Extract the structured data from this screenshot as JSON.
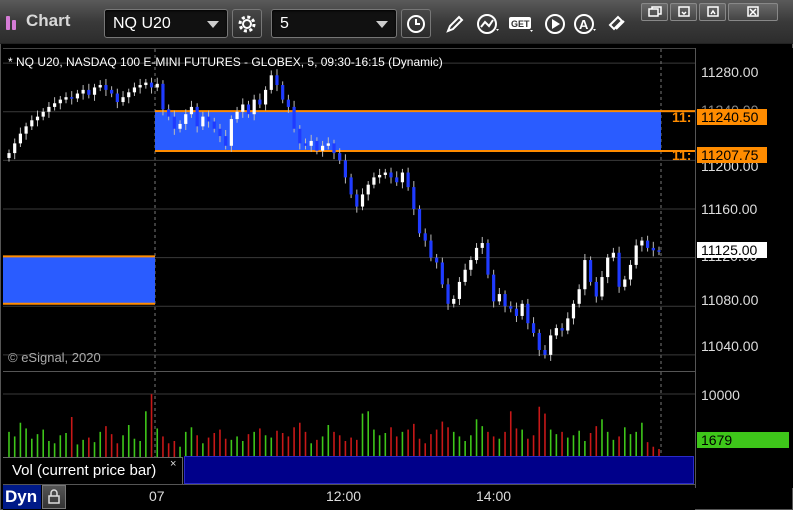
{
  "app": {
    "title": "Chart"
  },
  "toolbar": {
    "symbol": "NQ U20",
    "interval": "5",
    "icons": [
      "settings-gear-icon",
      "clock-icon",
      "pencil-draw-icon",
      "study-chart-icon",
      "get-quote-icon",
      "play-replay-icon",
      "alert-a-icon",
      "link-icon"
    ]
  },
  "window_controls": [
    "restore-icon",
    "minimize-icon",
    "maximize-icon",
    "close-icon"
  ],
  "chart": {
    "header": "* NQ U20, NASDAQ 100 E-MINI FUTURES - GLOBEX, 5, 09:30-16:15 (Dynamic)",
    "copyright": "© eSignal, 2020",
    "y_ticks": [
      "11280.00",
      "11240.00",
      "11200.00",
      "11160.00",
      "11120.00",
      "11080.00",
      "11040.00"
    ],
    "price_tags": {
      "upper": "11240.50",
      "lower": "11207.75",
      "last": "11125.00"
    },
    "clip_labels": {
      "upper": "11:",
      "lower": "11:"
    },
    "zone_color": "#2a5cff",
    "line_color": "#ff8c00",
    "up_color": "#ffffff",
    "down_color": "#1f3bff"
  },
  "volume": {
    "legend": "Vol (current price bar)",
    "close": "×",
    "y_tick": "10000",
    "last": "1679",
    "up_color": "#3ec61a",
    "down_color": "#c81818"
  },
  "time_axis": {
    "labels": [
      "07",
      "12:00",
      "14:00"
    ]
  },
  "footer": {
    "mode": "Dyn"
  },
  "chart_data": {
    "type": "candlestick",
    "title": "NQ U20, NASDAQ 100 E-MINI FUTURES - GLOBEX, 5, 09:30-16:15 (Dynamic)",
    "ylim": [
      11030,
      11290
    ],
    "zones": [
      {
        "from": 11207.75,
        "to": 11240.5
      },
      {
        "from": 11082,
        "to": 11121
      }
    ],
    "last_price": 11125.0,
    "volume_last": 1679,
    "closes": [
      11206,
      11214,
      11222,
      11228,
      11233,
      11236,
      11240,
      11244,
      11247,
      11250,
      11252,
      11251,
      11255,
      11258,
      11254,
      11260,
      11262,
      11258,
      11255,
      11248,
      11252,
      11256,
      11260,
      11262,
      11264,
      11260,
      11263,
      11242,
      11236,
      11226,
      11230,
      11238,
      11244,
      11228,
      11236,
      11232,
      11226,
      11220,
      11212,
      11234,
      11240,
      11246,
      11238,
      11250,
      11246,
      11258,
      11270,
      11262,
      11250,
      11244,
      11226,
      11214,
      11212,
      11216,
      11208,
      11212,
      11214,
      11206,
      11200,
      11186,
      11172,
      11162,
      11172,
      11180,
      11186,
      11188,
      11190,
      11186,
      11182,
      11190,
      11178,
      11160,
      11140,
      11134,
      11120,
      11116,
      11098,
      11082,
      11086,
      11100,
      11110,
      11118,
      11128,
      11132,
      11106,
      11084,
      11090,
      11080,
      11078,
      11072,
      11082,
      11066,
      11058,
      11044,
      11040,
      11056,
      11062,
      11060,
      11070,
      11082,
      11094,
      11118,
      11100,
      11088,
      11104,
      11120,
      11124,
      11096,
      11102,
      11114,
      11130,
      11134,
      11128,
      11126,
      11125
    ],
    "volume": [
      22,
      18,
      30,
      25,
      16,
      20,
      24,
      14,
      12,
      19,
      21,
      35,
      11,
      15,
      17,
      13,
      22,
      27,
      20,
      12,
      19,
      28,
      16,
      14,
      40,
      55,
      25,
      18,
      12,
      14,
      9,
      22,
      26,
      19,
      12,
      17,
      21,
      24,
      16,
      15,
      18,
      14,
      20,
      22,
      25,
      19,
      17,
      23,
      21,
      18,
      26,
      30,
      22,
      12,
      15,
      18,
      28,
      22,
      19,
      14,
      17,
      15,
      38,
      40,
      24,
      19,
      21,
      26,
      18,
      22,
      24,
      29,
      16,
      12,
      20,
      24,
      31,
      26,
      22,
      18,
      14,
      19,
      33,
      27,
      22,
      18,
      16,
      22,
      40,
      25,
      24,
      16,
      19,
      44,
      38,
      24,
      20,
      22,
      17,
      19,
      23,
      14,
      21,
      27,
      33,
      22,
      15,
      18,
      26,
      20,
      22,
      30,
      13,
      9,
      7
    ]
  }
}
